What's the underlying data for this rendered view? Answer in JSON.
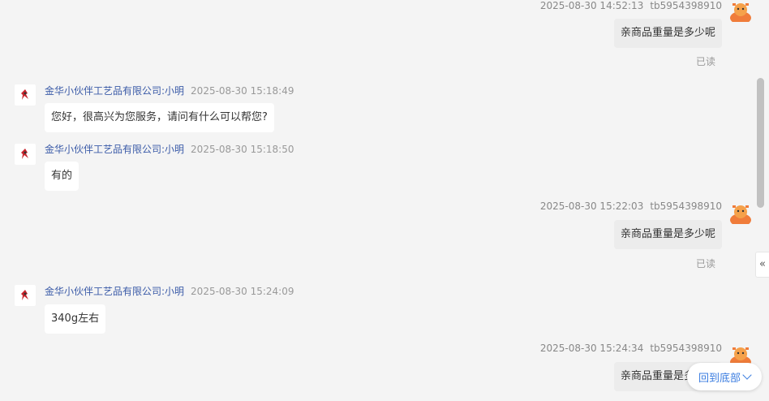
{
  "messages": [
    {
      "direction": "out",
      "time": "2025-08-30 14:52:13",
      "user": "tb5954398910",
      "text": "亲商品重量是多少呢",
      "read": "已读"
    },
    {
      "direction": "in",
      "sender": "金华小伙伴工艺品有限公司:小明",
      "time": "2025-08-30 15:18:49",
      "text": "您好，很高兴为您服务，请问有什么可以帮您?"
    },
    {
      "direction": "in",
      "sender": "金华小伙伴工艺品有限公司:小明",
      "time": "2025-08-30 15:18:50",
      "text": "有的"
    },
    {
      "direction": "out",
      "time": "2025-08-30 15:22:03",
      "user": "tb5954398910",
      "text": "亲商品重量是多少呢",
      "read": "已读"
    },
    {
      "direction": "in",
      "sender": "金华小伙伴工艺品有限公司:小明",
      "time": "2025-08-30 15:24:09",
      "text": "340g左右"
    },
    {
      "direction": "out",
      "time": "2025-08-30 15:24:34",
      "user": "tb5954398910",
      "text": "亲商品重量是多少呢"
    }
  ],
  "controls": {
    "back_to_bottom": "回到底部",
    "collapse_glyph": "«"
  },
  "icons": {
    "user_avatar": "cartoon-avatar-icon",
    "shop_avatar": "shop-logo-icon",
    "chevron": "chevron-down-icon"
  },
  "colors": {
    "sender_name": "#3b5ba8",
    "link_blue": "#3b7de0"
  }
}
